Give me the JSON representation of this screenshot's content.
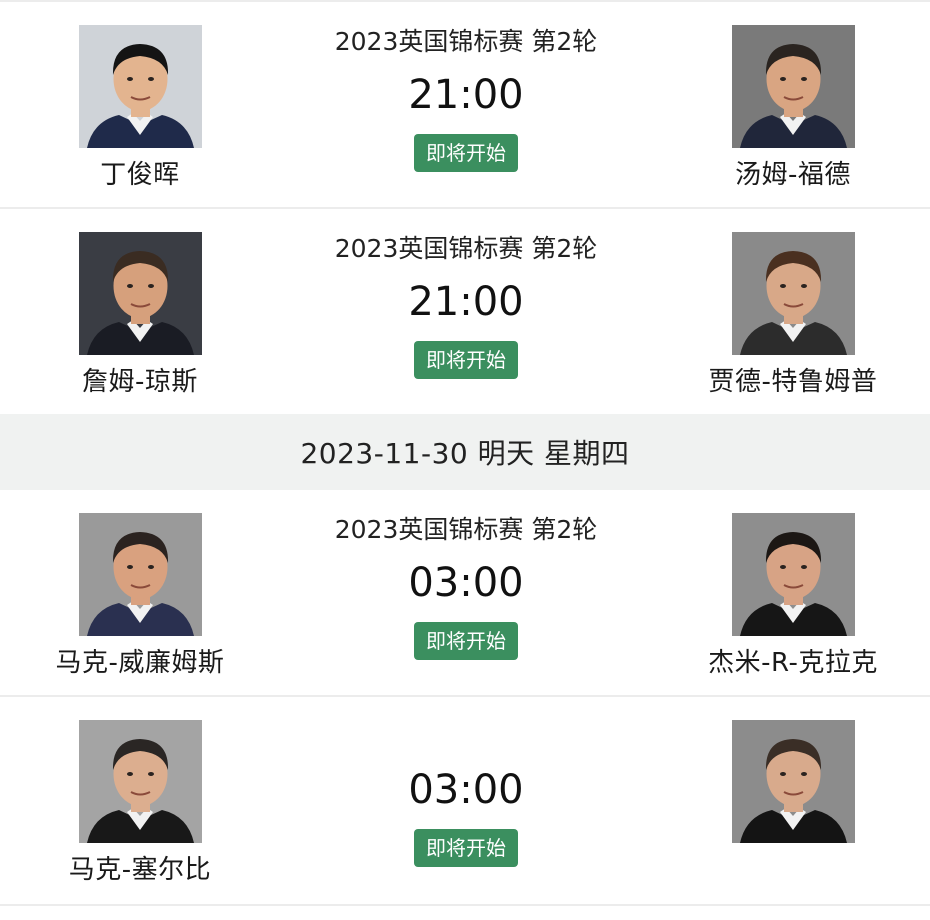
{
  "matches_day1": [
    {
      "event": "2023英国锦标赛 第2轮",
      "time": "21:00",
      "status": "即将开始",
      "left": {
        "name": "丁俊晖",
        "bg": "#cfd3d8",
        "suit": "#1f2a4a",
        "skin": "#e3b48f",
        "hair": "#141414"
      },
      "right": {
        "name": "汤姆-福德",
        "bg": "#7a7a7a",
        "suit": "#20263a",
        "skin": "#d9a582",
        "hair": "#2a2420"
      }
    },
    {
      "event": "2023英国锦标赛 第2轮",
      "time": "21:00",
      "status": "即将开始",
      "left": {
        "name": "詹姆-琼斯",
        "bg": "#3a3d44",
        "suit": "#1a1c24",
        "skin": "#d6a07c",
        "hair": "#3a2c22"
      },
      "right": {
        "name": "贾德-特鲁姆普",
        "bg": "#8a8a8a",
        "suit": "#2c2c2c",
        "skin": "#d8a888",
        "hair": "#4a3020"
      }
    }
  ],
  "date_divider": "2023-11-30 明天 星期四",
  "matches_day2": [
    {
      "event": "2023英国锦标赛 第2轮",
      "time": "03:00",
      "status": "即将开始",
      "left": {
        "name": "马克-威廉姆斯",
        "bg": "#9a9a9a",
        "suit": "#2a3050",
        "skin": "#d9a17f",
        "hair": "#2b2320"
      },
      "right": {
        "name": "杰米-R-克拉克",
        "bg": "#8e8e8e",
        "suit": "#161616",
        "skin": "#d7a385",
        "hair": "#1c1714"
      }
    },
    {
      "event": "",
      "time": "03:00",
      "status": "即将开始",
      "left": {
        "name": "马克-塞尔比",
        "bg": "#a4a4a4",
        "suit": "#181818",
        "skin": "#dcae8f",
        "hair": "#2a2624"
      },
      "right": {
        "name": "",
        "bg": "#8c8c8c",
        "suit": "#141414",
        "skin": "#d8aa8c",
        "hair": "#3a2e26"
      }
    }
  ]
}
